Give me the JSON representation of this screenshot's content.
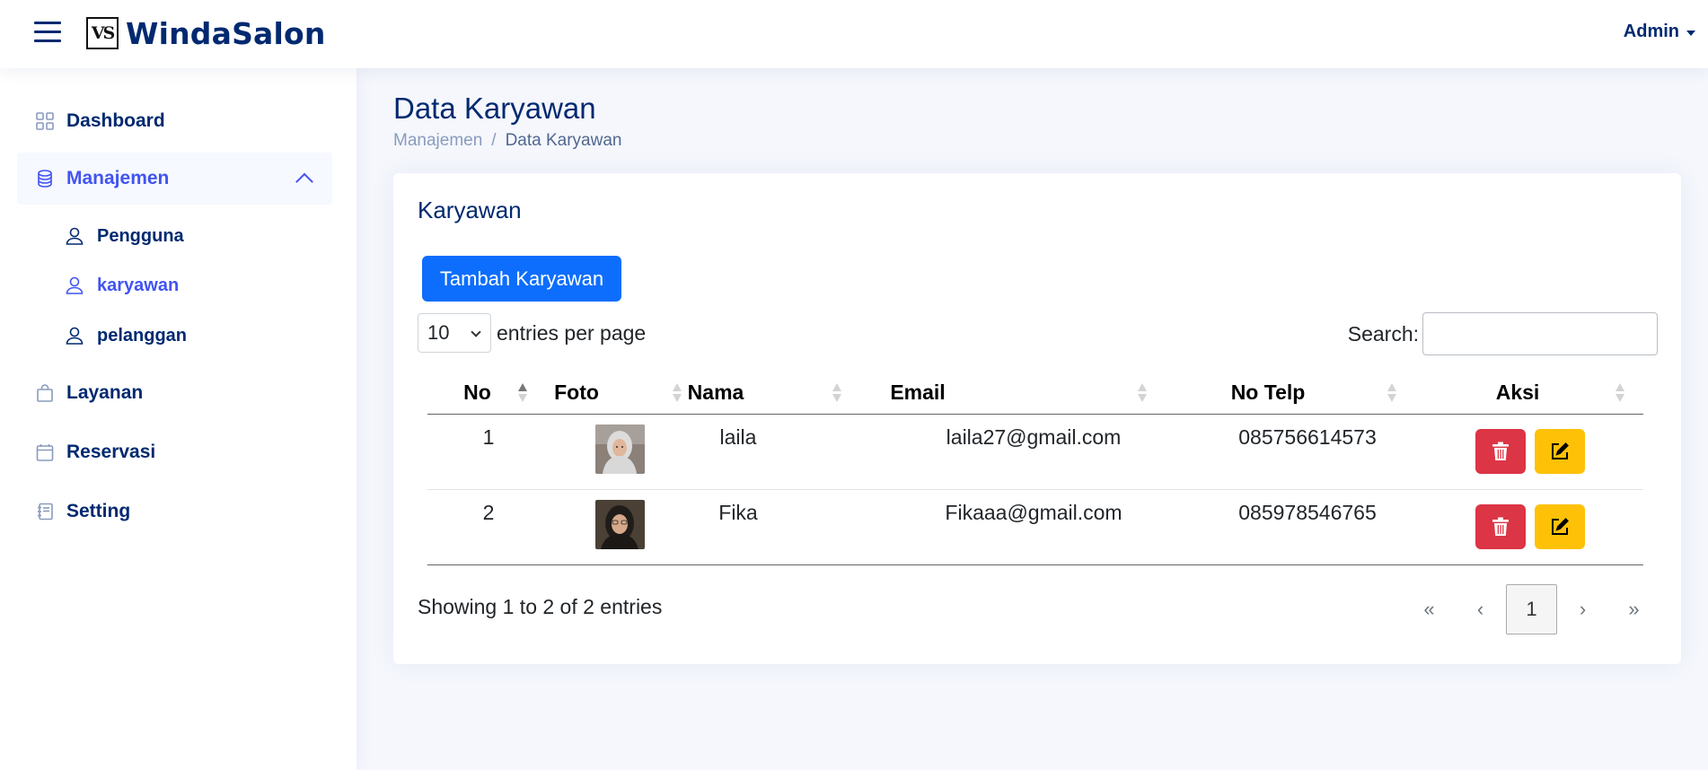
{
  "app": {
    "name": "WindaSalon",
    "logo_mark": "VS"
  },
  "header": {
    "user_label": "Admin"
  },
  "sidebar": {
    "items": [
      {
        "label": "Dashboard",
        "icon": "grid-icon"
      },
      {
        "label": "Manajemen",
        "icon": "database-icon",
        "expanded": true
      },
      {
        "label": "Layanan",
        "icon": "bag-icon"
      },
      {
        "label": "Reservasi",
        "icon": "calendar-icon"
      },
      {
        "label": "Setting",
        "icon": "journal-icon"
      }
    ],
    "subitems": [
      {
        "label": "Pengguna",
        "icon": "person-icon"
      },
      {
        "label": "karyawan",
        "icon": "person-icon",
        "current": true
      },
      {
        "label": "pelanggan",
        "icon": "person-icon"
      }
    ]
  },
  "page": {
    "title": "Data Karyawan",
    "breadcrumb": [
      "Manajemen",
      "/",
      "Data Karyawan"
    ]
  },
  "card": {
    "title": "Karyawan",
    "add_button": "Tambah Karyawan",
    "entries_value": "10",
    "entries_label": "entries per page",
    "search_label": "Search:",
    "search_value": "",
    "columns": [
      "No",
      "Foto",
      "Nama",
      "Email",
      "No Telp",
      "Aksi"
    ],
    "rows": [
      {
        "no": "1",
        "nama": "laila",
        "email": "laila27@gmail.com",
        "telp": "085756614573"
      },
      {
        "no": "2",
        "nama": "Fika",
        "email": "Fikaaa@gmail.com",
        "telp": "085978546765"
      }
    ],
    "showing": "Showing 1 to 2 of 2 entries",
    "pagination": [
      "«",
      "‹",
      "1",
      "›",
      "»"
    ]
  },
  "colors": {
    "primary": "#0d6efd",
    "navy": "#012970",
    "active": "#4154f1",
    "danger": "#dc3545",
    "warning": "#ffc107"
  }
}
